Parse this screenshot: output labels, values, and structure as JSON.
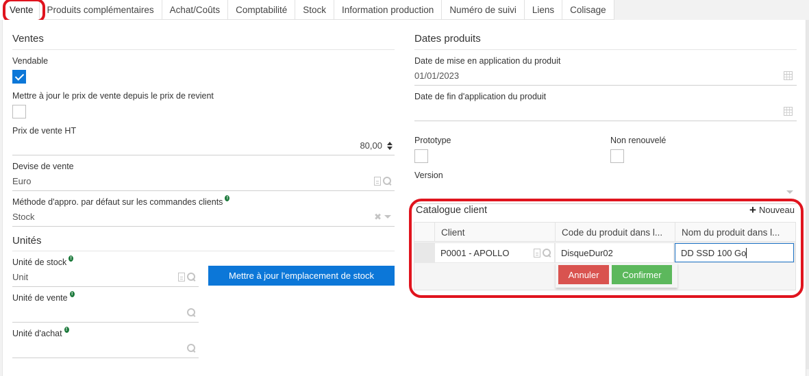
{
  "tabs": [
    {
      "label": "Vente",
      "active": true
    },
    {
      "label": "Produits complémentaires"
    },
    {
      "label": "Achat/Coûts"
    },
    {
      "label": "Comptabilité"
    },
    {
      "label": "Stock"
    },
    {
      "label": "Information production"
    },
    {
      "label": "Numéro de suivi"
    },
    {
      "label": "Liens"
    },
    {
      "label": "Colisage"
    }
  ],
  "left": {
    "ventes_title": "Ventes",
    "vendable": {
      "label": "Vendable",
      "checked": true
    },
    "update_price": {
      "label": "Mettre à jour le prix de vente depuis le prix de revient",
      "checked": false
    },
    "prix_vente": {
      "label": "Prix de vente HT",
      "value": "80,00"
    },
    "devise": {
      "label": "Devise de vente",
      "value": "Euro"
    },
    "methode": {
      "label": "Méthode d'appro. par défaut sur les commandes clients",
      "value": "Stock"
    },
    "unites_title": "Unités",
    "unite_stock": {
      "label": "Unité de stock",
      "value": "Unit"
    },
    "unite_vente": {
      "label": "Unité de vente",
      "value": ""
    },
    "unite_achat": {
      "label": "Unité d'achat",
      "value": ""
    },
    "update_location_button": "Mettre à jour l'emplacement de stock"
  },
  "right": {
    "dates_title": "Dates produits",
    "date_start": {
      "label": "Date de mise en application du produit",
      "value": "01/01/2023"
    },
    "date_end": {
      "label": "Date de fin d'application du produit",
      "value": ""
    },
    "prototype": {
      "label": "Prototype",
      "checked": false
    },
    "non_renouvele": {
      "label": "Non renouvelé",
      "checked": false
    },
    "version": {
      "label": "Version",
      "value": ""
    }
  },
  "catalogue": {
    "title": "Catalogue client",
    "new_label": "Nouveau",
    "columns": [
      "Client",
      "Code du produit dans l...",
      "Nom du produit dans l..."
    ],
    "row": {
      "client": "P0001 - APOLLO",
      "code": "DisqueDur02",
      "name": "DD SSD 100 Go"
    },
    "cancel_label": "Annuler",
    "confirm_label": "Confirmer"
  },
  "colors": {
    "primary": "#0c77d8",
    "cancel": "#d9534f",
    "confirm": "#5cb85c",
    "highlight": "#e0141e",
    "hint": "#1d7a3c"
  }
}
